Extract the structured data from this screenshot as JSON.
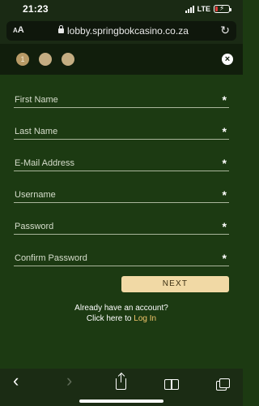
{
  "status_bar": {
    "time": "21:23",
    "network": "LTE",
    "battery_level": 0.2,
    "battery_color": "#e23a3a"
  },
  "browser": {
    "aa_label_small": "A",
    "aa_label_large": "A",
    "url": "lobby.springbokcasino.co.za",
    "icons": [
      "lock-icon",
      "reload-icon"
    ]
  },
  "steps": {
    "items": [
      "1",
      "",
      ""
    ],
    "active_index": 0,
    "close_icon": "close-icon"
  },
  "form": {
    "fields": [
      {
        "label": "First Name",
        "required": "*"
      },
      {
        "label": "Last Name",
        "required": "*"
      },
      {
        "label": "E-Mail Address",
        "required": "*"
      },
      {
        "label": "Username",
        "required": "*"
      },
      {
        "label": "Password",
        "required": "*"
      },
      {
        "label": "Confirm Password",
        "required": "*"
      }
    ],
    "next_label": "NEXT",
    "account_prompt": "Already have an account?",
    "login_prefix": "Click here to ",
    "login_link": "Log In"
  },
  "toolbar": {
    "back_glyph": "‹",
    "forward_glyph": "›",
    "icons": [
      "back-icon",
      "forward-icon",
      "share-icon",
      "bookmarks-icon",
      "tabs-icon"
    ]
  },
  "colors": {
    "form_background": "#1c3a12",
    "header_background": "#111e0c",
    "next_button": "#f1d9a5",
    "login_link": "#f1c56a",
    "step_dot": "#c4ad82"
  }
}
